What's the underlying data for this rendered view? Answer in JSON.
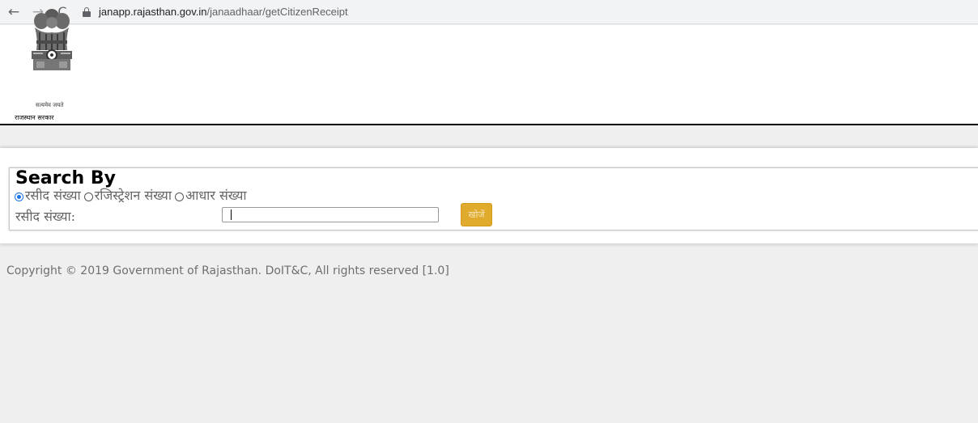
{
  "browser": {
    "back_icon": "←",
    "forward_icon": "→",
    "reload_icon": "C",
    "url_domain": "janapp.rajasthan.gov.in",
    "url_path": "/janaadhaar/getCitizenReceipt"
  },
  "header": {
    "emblem_motto": "सत्यमेव जयते",
    "gov_name": "राजस्थान सरकार"
  },
  "search": {
    "title": "Search By",
    "options": [
      {
        "label": "रसीद संख्या",
        "checked": true
      },
      {
        "label": "रजिस्ट्रेशन संख्या",
        "checked": false
      },
      {
        "label": "आधार संख्या",
        "checked": false
      }
    ],
    "field_label": "रसीद संख्या:",
    "input_value": "",
    "button_label": "खोजें"
  },
  "footer": {
    "copyright": "Copyright © 2019 Government of Rajasthan. DoIT&C, All rights reserved [1.0]"
  },
  "colors": {
    "page_bg": "#efefef",
    "search_button": "#e0aa2d",
    "radio_checked": "#1a73e8"
  }
}
